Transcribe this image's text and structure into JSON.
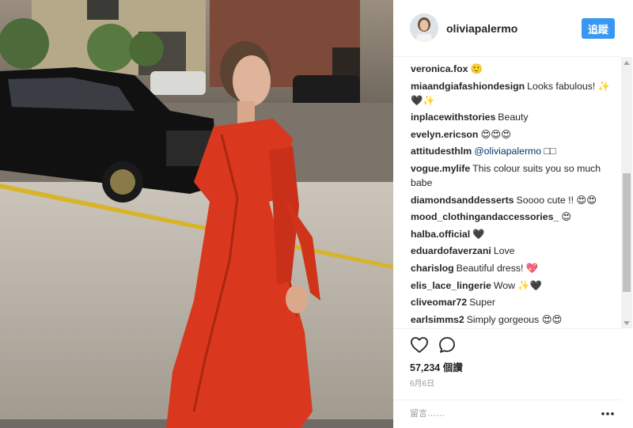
{
  "header": {
    "username": "oliviapalermo",
    "follow_label": "追蹤"
  },
  "comments": [
    {
      "user": "veronica.fox",
      "text": "🙂"
    },
    {
      "user": "miaandgiafashiondesign",
      "text": "Looks fabulous! ✨🖤✨"
    },
    {
      "user": "inplacewithstories",
      "text": "Beauty"
    },
    {
      "user": "evelyn.ericson",
      "text": "😍😍😍"
    },
    {
      "user": "attitudesthlm",
      "mention": "@oliviapalermo",
      "text": " □□"
    },
    {
      "user": "vogue.mylife",
      "text": "This colour suits you so much babe"
    },
    {
      "user": "diamondsanddesserts",
      "text": "Soooo cute !! 😍😍"
    },
    {
      "user": "mood_clothingandaccessories_",
      "text": "😍"
    },
    {
      "user": "halba.official",
      "text": "🖤"
    },
    {
      "user": "eduardofaverzani",
      "text": "Love"
    },
    {
      "user": "charislog",
      "text": "Beautiful dress! 💖"
    },
    {
      "user": "elis_lace_lingerie",
      "text": "Wow ✨🖤"
    },
    {
      "user": "cliveomar72",
      "text": "Super"
    },
    {
      "user": "earlsimms2",
      "text": "Simply gorgeous 😍😍"
    }
  ],
  "actions": {
    "likes": "57,234 個讚",
    "date": "6月6日"
  },
  "add_comment": {
    "placeholder": "留言……"
  },
  "icons": {
    "like": "heart-outline-icon",
    "comment": "speech-bubble-icon",
    "more": "more-dots-icon"
  },
  "colors": {
    "accent": "#3897f0",
    "dress": "#d9381e"
  }
}
